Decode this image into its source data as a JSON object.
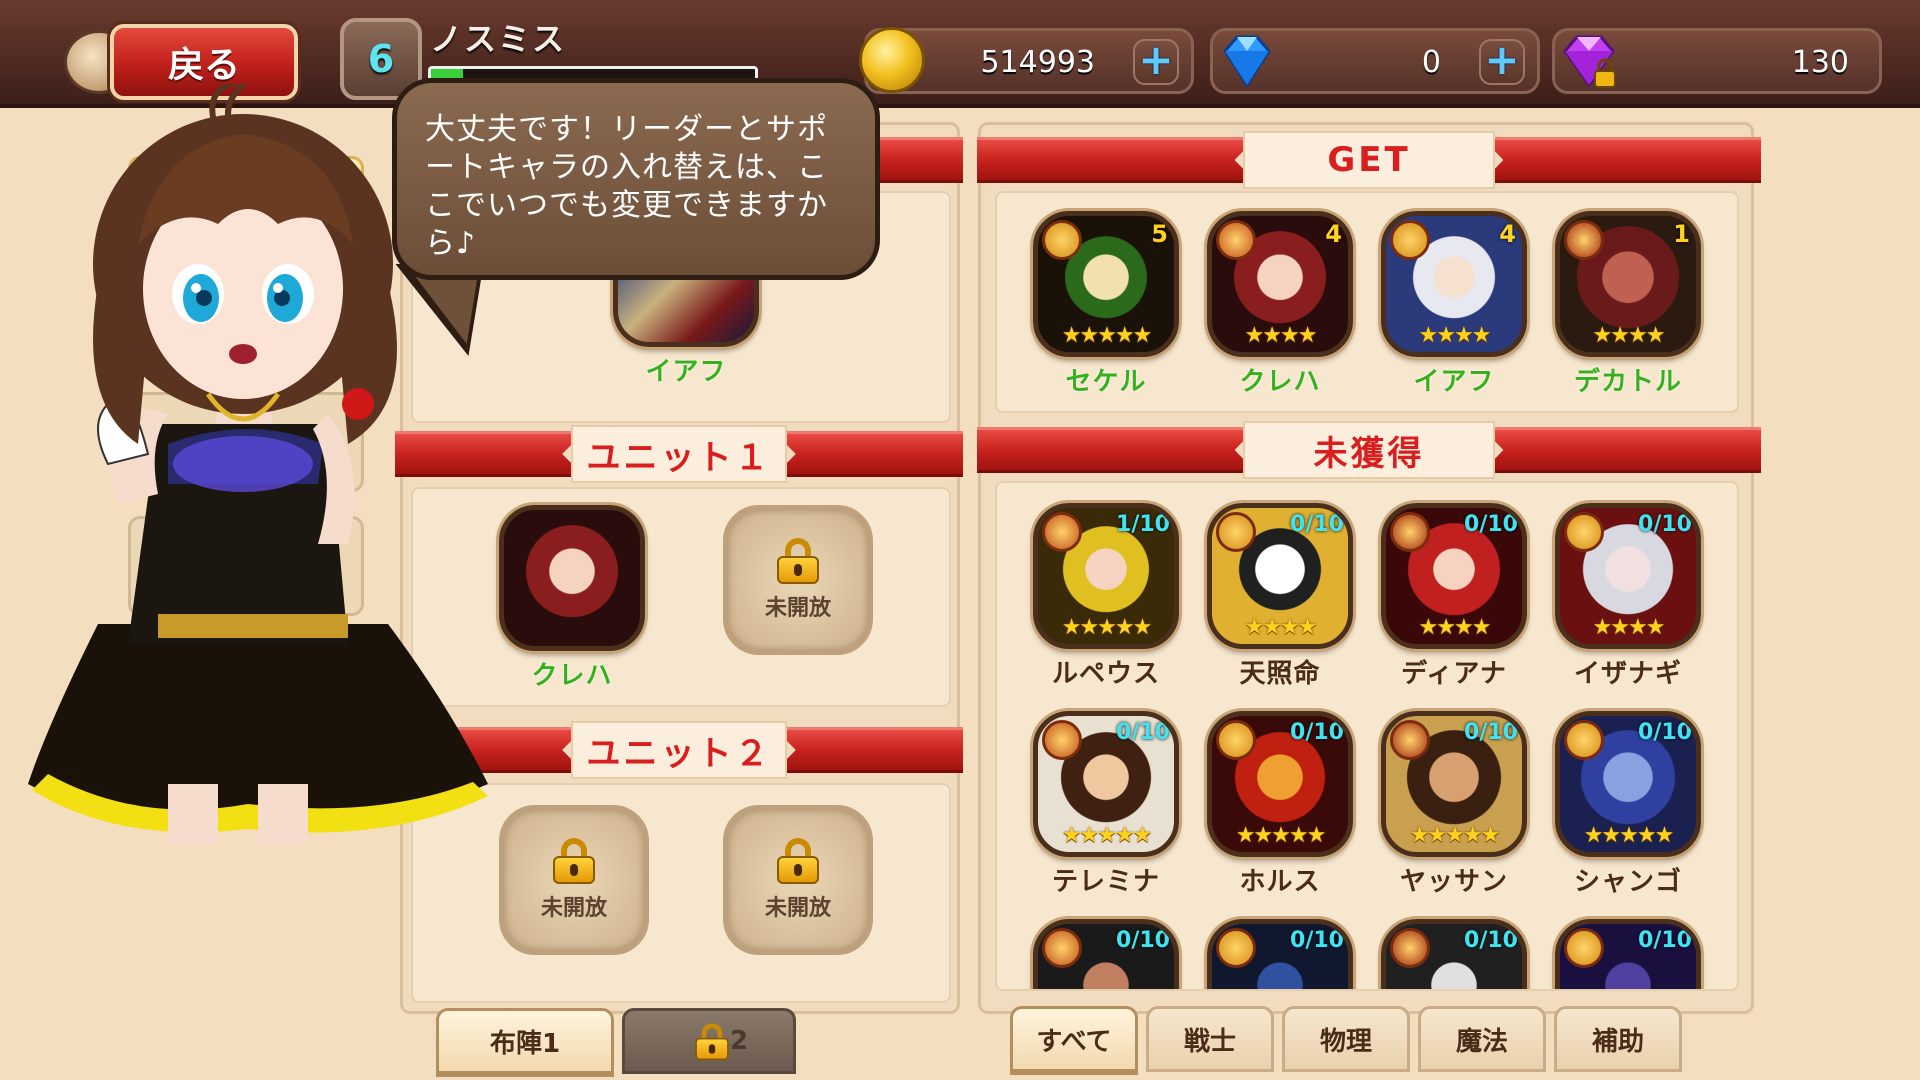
{
  "topbar": {
    "back_label": "戻る",
    "player_level": "6",
    "player_name": "ノスミス",
    "exp_fraction": 0.1,
    "gold": "514993",
    "gems": "0",
    "paid_gems": "130"
  },
  "speech": {
    "text": "大丈夫です！リーダーとサポートキャラの入れ替えは、ここでいつでも変更できますから♪"
  },
  "leader": {
    "name": "イアフ"
  },
  "unit1": {
    "title": "ユニット１",
    "slot1_name": "クレハ",
    "slot2_label": "未開放"
  },
  "unit2": {
    "title": "ユニット２",
    "slot1_label": "未開放",
    "slot2_label": "未開放"
  },
  "formation_tabs": [
    {
      "label": "布陣1",
      "active": true
    },
    {
      "label": "2",
      "locked": true
    }
  ],
  "owned": {
    "title": "GET",
    "characters": [
      {
        "name": "セケル",
        "count": "5",
        "stars": 5
      },
      {
        "name": "クレハ",
        "count": "4",
        "stars": 4
      },
      {
        "name": "イアフ",
        "count": "4",
        "stars": 4
      },
      {
        "name": "デカトル",
        "count": "1",
        "stars": 4
      }
    ]
  },
  "unowned": {
    "title": "未獲得",
    "characters": [
      {
        "name": "ルペウス",
        "frac": "1/10",
        "stars": 5
      },
      {
        "name": "天照命",
        "frac": "0/10",
        "stars": 4
      },
      {
        "name": "ディアナ",
        "frac": "0/10",
        "stars": 4
      },
      {
        "name": "イザナギ",
        "frac": "0/10",
        "stars": 4
      },
      {
        "name": "テレミナ",
        "frac": "0/10",
        "stars": 5
      },
      {
        "name": "ホルス",
        "frac": "0/10",
        "stars": 5
      },
      {
        "name": "ヤッサン",
        "frac": "0/10",
        "stars": 5
      },
      {
        "name": "シャンゴ",
        "frac": "0/10",
        "stars": 5
      },
      {
        "name": "",
        "frac": "0/10",
        "stars": 0
      },
      {
        "name": "",
        "frac": "0/10",
        "stars": 0
      },
      {
        "name": "",
        "frac": "0/10",
        "stars": 0
      },
      {
        "name": "",
        "frac": "0/10",
        "stars": 0
      }
    ]
  },
  "filter_tabs": [
    {
      "label": "すべて",
      "active": true
    },
    {
      "label": "戦士"
    },
    {
      "label": "物理"
    },
    {
      "label": "魔法"
    },
    {
      "label": "補助"
    }
  ],
  "colors": {
    "ribbon_red": "#c8221f",
    "owned_name_green": "#37b01e",
    "fraction_cyan": "#40e4f0",
    "star_gold": "#ffd21f"
  }
}
